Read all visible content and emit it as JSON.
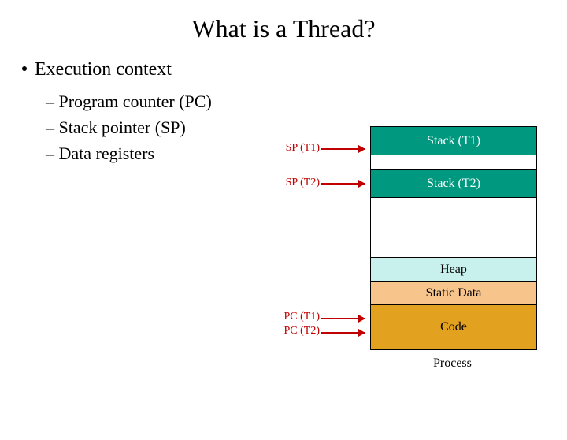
{
  "title": "What is a Thread?",
  "main_bullet": "Execution context",
  "sub_bullets": {
    "a": "Program counter (PC)",
    "b": "Stack pointer (SP)",
    "c": "Data registers"
  },
  "pointers": {
    "sp_t1": "SP (T1)",
    "sp_t2": "SP (T2)",
    "pc_t1": "PC (T1)",
    "pc_t2": "PC (T2)"
  },
  "segments": {
    "stack_t1": "Stack (T1)",
    "stack_t2": "Stack (T2)",
    "heap": "Heap",
    "static_data": "Static Data",
    "code": "Code"
  },
  "caption": "Process"
}
